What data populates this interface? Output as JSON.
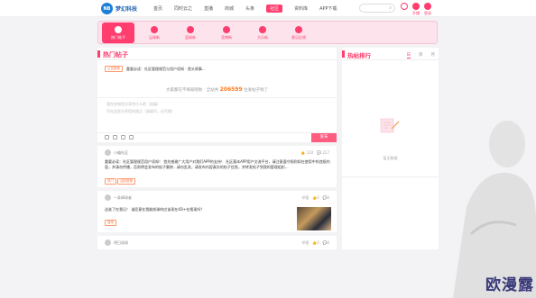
{
  "logo": {
    "mark": "NB",
    "text": "梦幻科技"
  },
  "nav": [
    "首页",
    "同时云之",
    "直播",
    "商城",
    "头条",
    "社区",
    "资料库",
    "APP下载"
  ],
  "nav_active": "社区",
  "search_placeholder": "",
  "top_icons": [
    {
      "label": "开播"
    },
    {
      "label": "登录"
    }
  ],
  "categories": [
    {
      "label": "热门帖子",
      "active": true
    },
    {
      "label": "足球新"
    },
    {
      "label": "篮球新"
    },
    {
      "label": "竞博新"
    },
    {
      "label": "大乐新"
    },
    {
      "label": "意见反馈"
    }
  ],
  "main": {
    "title": "热门帖子",
    "notice_tag": "公告推荐",
    "notice_text": "重要必读：社区管理规范与用户须知 · 首头原事…",
    "count_prefix": "大家都在不择知晓啦 · 全站共",
    "count_value": "206599",
    "count_suffix": "位发帖子啦了",
    "placeholder1": "我在快和您分享些什么吧（选填）",
    "placeholder2": "写在这里分享您的观点（请填写，还写哦）",
    "post_button": "发布"
  },
  "posts": [
    {
      "user": "小编社区",
      "views": "120",
      "likes": "227",
      "text": "重要必读：社区管理规范用户须知！ 首先感谢广大用户对我们APP的支持！ 社区基本APP用户交流平台，请注意遵守规则如在使用中的违规内容，并请勿传播，否则将会发布的帖子删除...请勿乱发，请发布内容真实的帖子信息，并转发帖子到我的管理组织...",
      "tags": [
        "热门",
        "活跃推荐"
      ]
    },
    {
      "user": "一条棒球者",
      "views": "",
      "likes": "0",
      "comments": "0",
      "text": "这谁了在我记！ 谁愿意在我能前球的应该现在4D+在搜现吗？",
      "tags": [
        "篮球"
      ]
    },
    {
      "user": "明日说球",
      "views": "",
      "likes": "0",
      "comments": "0"
    }
  ],
  "side": {
    "title": "热帖排行",
    "tabs": [
      "日",
      "周",
      "月"
    ],
    "active_tab": "日",
    "empty_text": "暂无数据"
  },
  "watermark": "欧漫露"
}
